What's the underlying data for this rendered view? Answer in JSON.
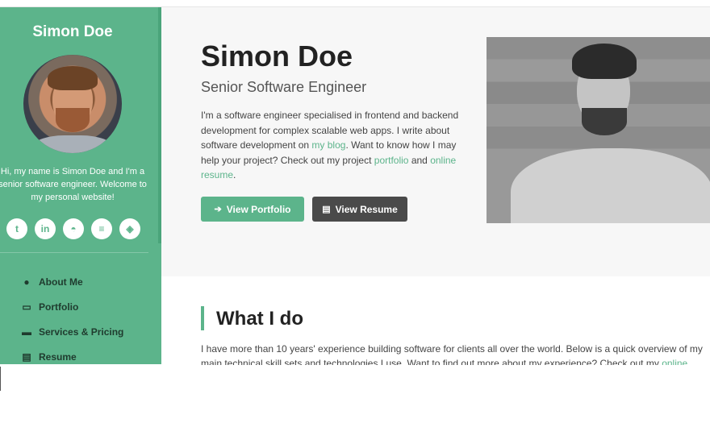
{
  "sidebar": {
    "site_name": "Simon Doe",
    "bio": "Hi, my name is Simon Doe and I'm a senior software engineer. Welcome to my personal website!",
    "socials": [
      {
        "icon": "twitter-icon",
        "glyph": "t"
      },
      {
        "icon": "linkedin-icon",
        "glyph": "in"
      },
      {
        "icon": "github-icon",
        "glyph": "◓"
      },
      {
        "icon": "stackoverflow-icon",
        "glyph": "≡"
      },
      {
        "icon": "codepen-icon",
        "glyph": "◈"
      }
    ],
    "nav": [
      {
        "label": "About Me",
        "icon": "user-icon",
        "glyph": "●"
      },
      {
        "label": "Portfolio",
        "icon": "laptop-icon",
        "glyph": "▭"
      },
      {
        "label": "Services & Pricing",
        "icon": "briefcase-icon",
        "glyph": "▬"
      },
      {
        "label": "Resume",
        "icon": "file-icon",
        "glyph": "▤"
      }
    ]
  },
  "hero": {
    "name": "Simon Doe",
    "tagline": "Senior Software Engineer",
    "intro_1": "I'm a software engineer specialised in frontend and backend development for complex scalable web apps. I write about software development on ",
    "intro_link_blog": "my blog",
    "intro_2": ". Want to know how I may help your project? Check out my project ",
    "intro_link_portfolio": "portfolio",
    "intro_3": " and ",
    "intro_link_resume": "online resume",
    "intro_4": ".",
    "btn_portfolio": "View Portfolio",
    "btn_resume": "View Resume"
  },
  "section": {
    "title": "What I do",
    "text_1": "I have more than 10 years' experience building software for clients all over the world. Below is a quick overview of my main technical skill sets and technologies I use. Want to find out more about my experience? Check out my ",
    "text_link": "online"
  },
  "colors": {
    "accent": "#5cb48b",
    "dark_button": "#4a4a4a"
  }
}
